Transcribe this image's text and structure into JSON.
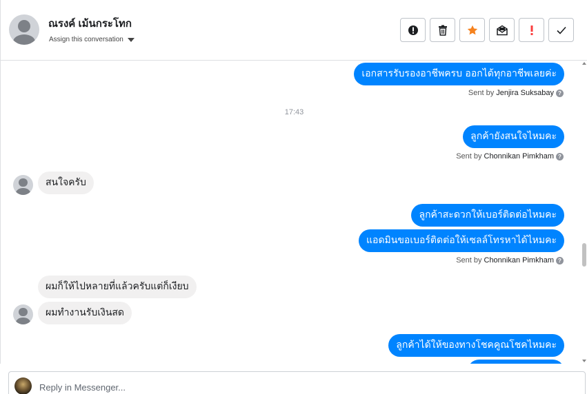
{
  "header": {
    "contact_name": "ณรงค์ เม้นกระโทก",
    "assign_label": "Assign this conversation",
    "actions": [
      {
        "icon": "alert-circle-icon"
      },
      {
        "icon": "trash-icon"
      },
      {
        "icon": "star-icon",
        "color": "#f5821f"
      },
      {
        "icon": "mail-icon"
      },
      {
        "icon": "exclamation-icon",
        "color": "#fa3e3e"
      },
      {
        "icon": "check-icon"
      }
    ]
  },
  "thread": {
    "messages": [
      {
        "dir": "out",
        "text": "เอกสารรับรองอาชีพครบ ออกได้ทุกอาชีพเลยค่ะ"
      },
      {
        "sent_by_prefix": "Sent by",
        "sender": "Jenjira Suksabay"
      },
      {
        "timestamp": "17:43"
      },
      {
        "dir": "out",
        "text": "ลูกค้ายังสนใจไหมคะ"
      },
      {
        "sent_by_prefix": "Sent by",
        "sender": "Chonnikan Pimkham"
      },
      {
        "dir": "in",
        "text": "สนใจครับ"
      },
      {
        "dir": "out",
        "text": "ลูกค้าสะดวกให้เบอร์ติดต่อไหมคะ"
      },
      {
        "dir": "out",
        "text": "แอดมินขอเบอร์ติดต่อให้เซลล์โทรหาได้ไหมคะ"
      },
      {
        "sent_by_prefix": "Sent by",
        "sender": "Chonnikan Pimkham"
      },
      {
        "dir": "in",
        "text": "ผมก็ให้ไปหลายที่แล้วครับแต่ก็เงียบ"
      },
      {
        "dir": "in",
        "text": "ผมทำงานรับเงินสด"
      },
      {
        "dir": "out",
        "text": "ลูกค้าได้ให้ของทางโชคคูณโชคไหมคะ"
      }
    ],
    "help_glyph": "?"
  },
  "reply": {
    "placeholder": "Reply in Messenger..."
  },
  "colors": {
    "accent": "#0084ff",
    "incoming_bubble": "#f1f0f0"
  }
}
